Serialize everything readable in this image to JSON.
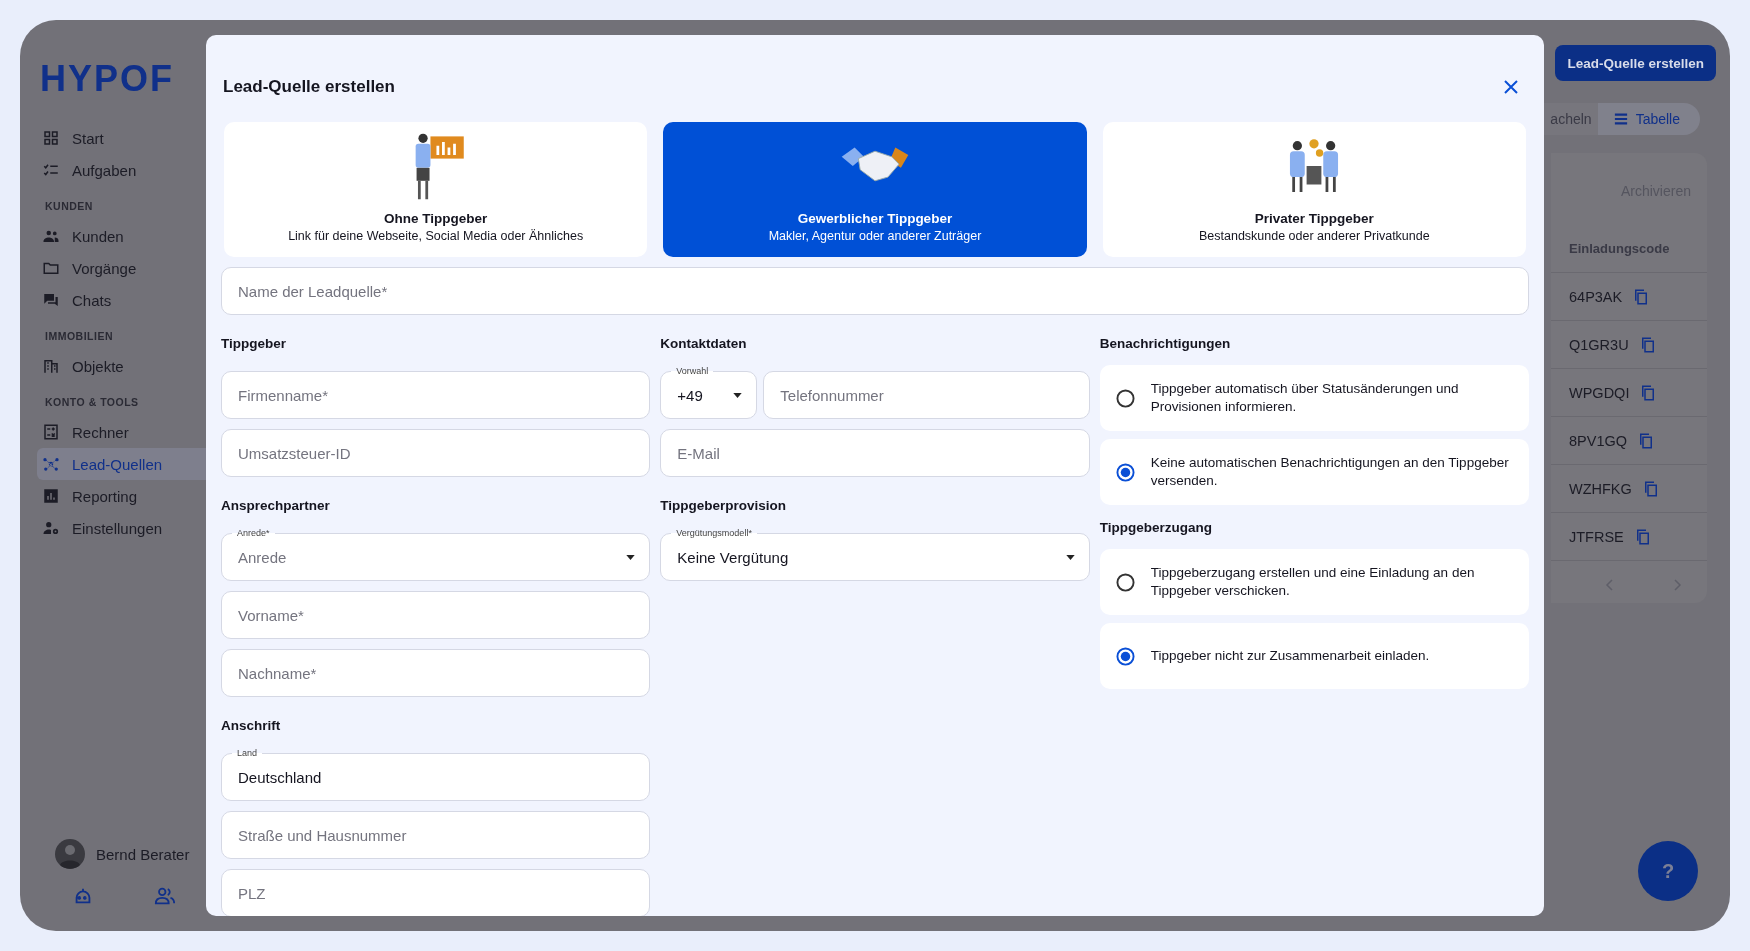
{
  "sidebar": {
    "logo": "HYPOF",
    "groups": [
      {
        "items": [
          {
            "label": "Start",
            "selected": false
          },
          {
            "label": "Aufgaben",
            "selected": false
          }
        ]
      },
      {
        "heading": "KUNDEN",
        "items": [
          {
            "label": "Kunden",
            "selected": false
          },
          {
            "label": "Vorgänge",
            "selected": false
          },
          {
            "label": "Chats",
            "selected": false
          }
        ]
      },
      {
        "heading": "IMMOBILIEN",
        "items": [
          {
            "label": "Objekte",
            "selected": false
          }
        ]
      },
      {
        "heading": "KONTO & TOOLS",
        "items": [
          {
            "label": "Rechner",
            "selected": false
          },
          {
            "label": "Lead-Quellen",
            "selected": true
          },
          {
            "label": "Reporting",
            "selected": false
          },
          {
            "label": "Einstellungen",
            "selected": false
          }
        ]
      }
    ],
    "user": {
      "name": "Bernd Berater"
    }
  },
  "background": {
    "create_button": "Lead-Quelle erstellen",
    "view_tabs": [
      {
        "label": "acheln",
        "selected": false
      },
      {
        "label": "Tabelle",
        "selected": true
      }
    ],
    "archive_button": "Archivieren",
    "table": {
      "column": "Einladungscode",
      "rows": [
        "64P3AK",
        "Q1GR3U",
        "WPGDQI",
        "8PV1GQ",
        "WZHFKG",
        "JTFRSE"
      ]
    },
    "help_button": "?"
  },
  "modal": {
    "title": "Lead-Quelle erstellen",
    "types": [
      {
        "title": "Ohne Tippgeber",
        "subtitle": "Link für deine Webseite, Social Media oder Ähnliches",
        "selected": false
      },
      {
        "title": "Gewerblicher Tippgeber",
        "subtitle": "Makler, Agentur oder anderer Zuträger",
        "selected": true
      },
      {
        "title": "Privater Tippgeber",
        "subtitle": "Bestandskunde oder anderer Privatkunde",
        "selected": false
      }
    ],
    "name_field": {
      "placeholder": "Name der Leadquelle*"
    },
    "tippgeber": {
      "heading": "Tippgeber",
      "fields": [
        {
          "placeholder": "Firmenname*"
        },
        {
          "placeholder": "Umsatzsteuer-ID"
        }
      ]
    },
    "ansprechpartner": {
      "heading": "Ansprechpartner",
      "salutation": {
        "label": "Anrede*",
        "placeholder": "Anrede"
      },
      "fields": [
        {
          "placeholder": "Vorname*"
        },
        {
          "placeholder": "Nachname*"
        }
      ]
    },
    "anschrift": {
      "heading": "Anschrift",
      "country": {
        "label": "Land",
        "value": "Deutschland"
      },
      "fields": [
        {
          "placeholder": "Straße und Hausnummer"
        },
        {
          "placeholder": "PLZ"
        }
      ]
    },
    "kontaktdaten": {
      "heading": "Kontaktdaten",
      "prefix": {
        "label": "Vorwahl",
        "value": "+49"
      },
      "phone": {
        "placeholder": "Telefonnummer"
      },
      "email": {
        "placeholder": "E-Mail"
      }
    },
    "provision": {
      "heading": "Tippgeberprovision",
      "model": {
        "label": "Vergütungsmodell*",
        "value": "Keine Vergütung"
      }
    },
    "benachrichtigungen": {
      "heading": "Benachrichtigungen",
      "options": [
        {
          "label": "Tippgeber automatisch über Statusänderungen und Provisionen informieren.",
          "selected": false
        },
        {
          "label": "Keine automatischen Benachrichtigungen an den Tippgeber versenden.",
          "selected": true
        }
      ]
    },
    "zugang": {
      "heading": "Tippgeberzugang",
      "options": [
        {
          "label": "Tippgeberzugang erstellen und eine Einladung an den Tippgeber verschicken.",
          "selected": false
        },
        {
          "label": "Tippgeber nicht zur Zusammenarbeit einladen.",
          "selected": true
        }
      ]
    }
  }
}
